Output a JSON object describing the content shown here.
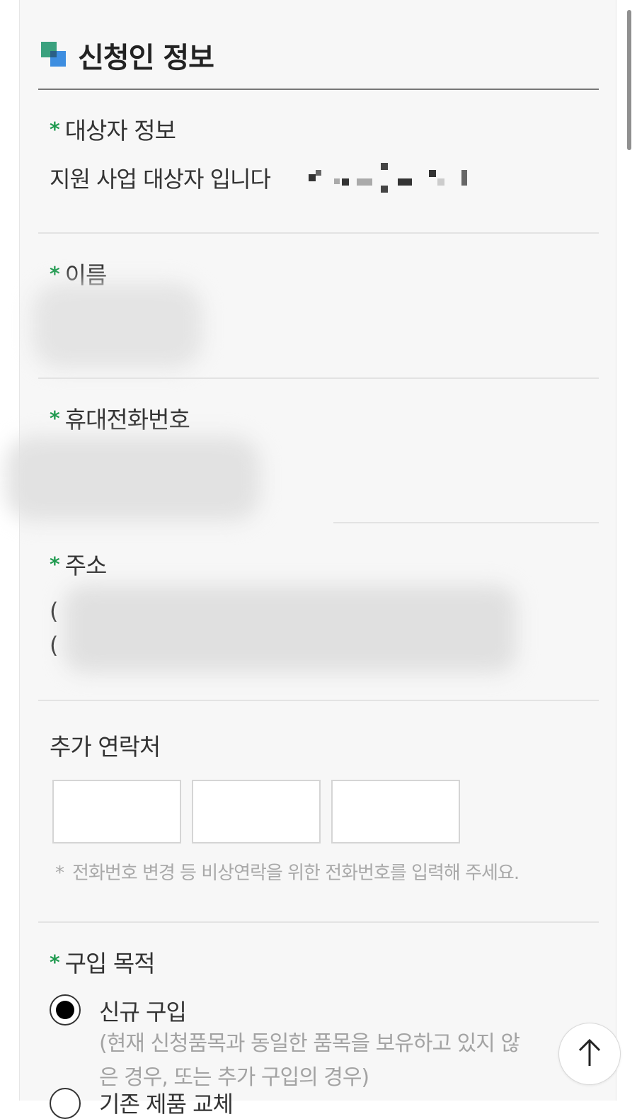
{
  "section": {
    "title": "신청인 정보"
  },
  "fields": {
    "target_info": {
      "label": "대상자 정보",
      "value": "지원 사업 대상자 입니다"
    },
    "name": {
      "label": "이름"
    },
    "mobile": {
      "label": "휴대전화번호"
    },
    "address": {
      "label": "주소",
      "line1_prefix": "(",
      "line2_prefix": "("
    },
    "extra_contact": {
      "label": "추가 연락처",
      "hint_mark": "*",
      "hint": "전화번호 변경 등 비상연락을 위한 전화번호를 입력해 주세요."
    },
    "purpose": {
      "label": "구입 목적",
      "options": [
        {
          "label": "신규 구입",
          "description": "(현재 신청품목과 동일한 품목을 보유하고 있지 않은 경우, 또는 추가 구입의 경우)",
          "selected": true
        },
        {
          "label": "기존 제품 교체",
          "selected": false
        }
      ]
    }
  },
  "required_mark": "*",
  "icons": {
    "section_mark": "section-bullet-icon",
    "scroll_top": "arrow-up-icon"
  },
  "colors": {
    "required": "#1f9a4f",
    "section_mark_green": "#3aa17e",
    "section_mark_blue": "#3e8ee0"
  }
}
